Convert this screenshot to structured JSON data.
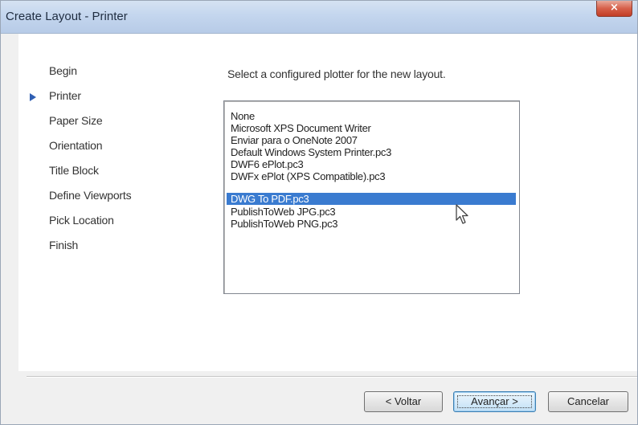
{
  "window": {
    "title": "Create Layout - Printer",
    "close_symbol": "×"
  },
  "steps": [
    {
      "label": "Begin",
      "current": false
    },
    {
      "label": "Printer",
      "current": true
    },
    {
      "label": "Paper Size",
      "current": false
    },
    {
      "label": "Orientation",
      "current": false
    },
    {
      "label": "Title Block",
      "current": false
    },
    {
      "label": "Define Viewports",
      "current": false
    },
    {
      "label": "Pick Location",
      "current": false
    },
    {
      "label": "Finish",
      "current": false
    }
  ],
  "instruction": "Select a configured plotter for the new layout.",
  "plotters": [
    "None",
    "Microsoft XPS Document Writer",
    "Enviar para o OneNote 2007",
    "Default Windows System Printer.pc3",
    "DWF6 ePlot.pc3",
    "DWFx ePlot (XPS Compatible).pc3",
    "DWG To PDF.pc3",
    "PublishToWeb JPG.pc3",
    "PublishToWeb PNG.pc3"
  ],
  "selected_plotter": "DWG To PDF.pc3",
  "buttons": {
    "back": "< Voltar",
    "next": "Avançar >",
    "cancel": "Cancelar"
  },
  "icons": {
    "current_step": "arrow-right-icon",
    "cursor": "mouse-pointer-icon",
    "close": "close-icon"
  },
  "colors": {
    "selection": "#3a7bd0",
    "step_arrow": "#2f5fb3",
    "close_button": "#c94a33"
  }
}
